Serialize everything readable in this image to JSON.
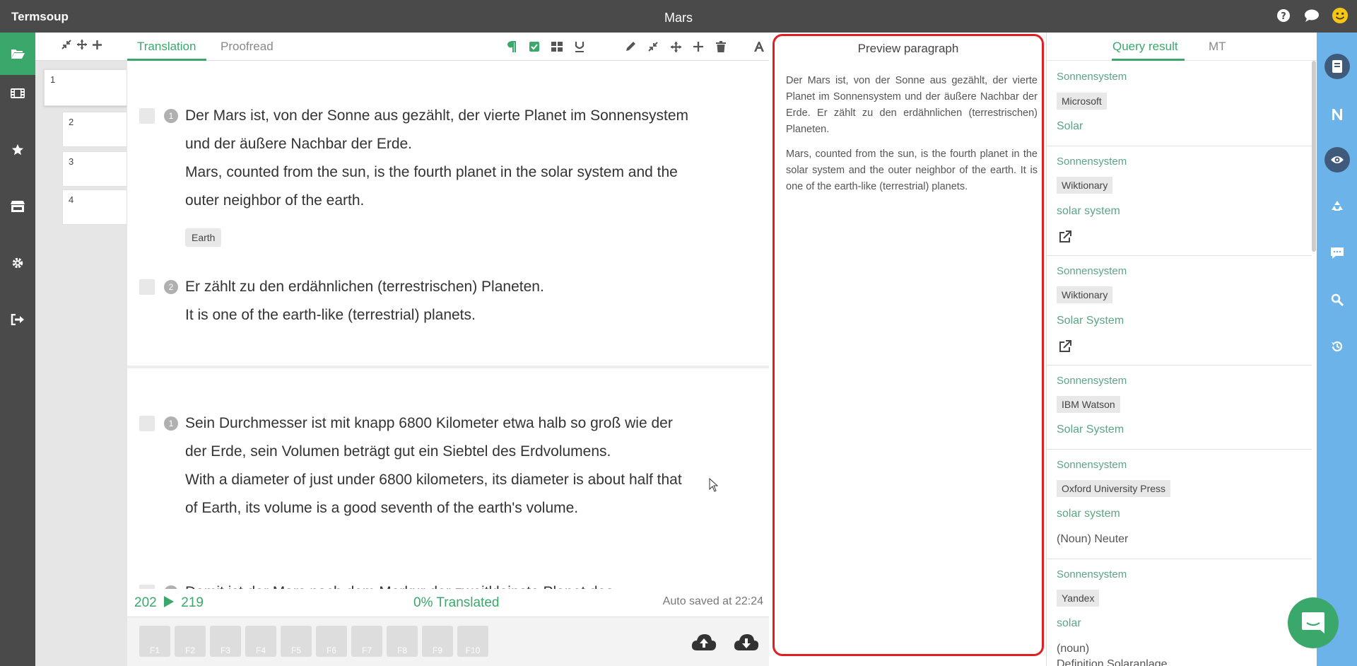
{
  "app": {
    "name": "Termsoup",
    "document_title": "Mars"
  },
  "colors": {
    "accent": "#3aa86b",
    "dark": "#4a4a4a",
    "preview_border": "#e02020",
    "right_nav": "#6cb3ea"
  },
  "topbar_icons": [
    "help-icon",
    "chat-icon",
    "smiley-icon"
  ],
  "left_nav": [
    "folder-open-icon",
    "film-icon",
    "star-icon",
    "store-icon",
    "gear-icon",
    "sign-out-icon"
  ],
  "page_strip": {
    "tools": [
      "compress-icon",
      "move-icon",
      "plus-icon"
    ],
    "pages": [
      "1",
      "2",
      "3",
      "4"
    ]
  },
  "editor": {
    "tabs": [
      {
        "label": "Translation"
      },
      {
        "label": "Proofread"
      }
    ],
    "toolbar": [
      "paragraph-icon",
      "check-square-icon",
      "grid-icon",
      "underline-icon",
      "pencil-icon",
      "compress-icon",
      "move-icon",
      "plus-icon",
      "trash-icon",
      "font-icon"
    ],
    "paragraphs": [
      {
        "segments": [
          {
            "number": "1",
            "source": "Der Mars ist, von der Sonne aus gezählt, der vierte Planet im Sonnensystem und der äußere Nachbar der Erde.",
            "target": "Mars, counted from the sun, is the fourth planet in the solar system and the outer neighbor of the earth.",
            "chip": "Earth"
          },
          {
            "number": "2",
            "source": "Er zählt zu den erdähnlichen (terrestrischen) Planeten.",
            "target": "It is one of the earth-like (terrestrial) planets."
          }
        ]
      },
      {
        "segments": [
          {
            "number": "1",
            "source": "Sein Durchmesser ist mit knapp 6800 Kilometer etwa halb so groß wie der der Erde, sein Volumen beträgt gut ein Siebtel des Erdvolumens.",
            "target": "With a diameter of just under 6800 kilometers, its diameter is about half that of Earth, its volume is a good seventh of the earth's volume."
          },
          {
            "number": "2",
            "source": "Damit ist der Mars nach dem Merkur der zweitkleinste Planet des"
          }
        ]
      }
    ],
    "status": {
      "from": "202",
      "to": "219",
      "progress": "0% Translated",
      "saved": "Auto saved at 22:24"
    },
    "function_keys": [
      "F1",
      "F2",
      "F3",
      "F4",
      "F5",
      "F6",
      "F7",
      "F8",
      "F9",
      "F10"
    ],
    "cloud_icons": [
      "cloud-upload-icon",
      "cloud-download-icon"
    ]
  },
  "preview": {
    "title": "Preview paragraph",
    "paragraphs": [
      "Der Mars ist, von der Sonne aus gezählt, der vierte Planet im Sonnensystem und der äußere Nachbar der Erde. Er zählt zu den erdähnlichen (terrestrischen) Planeten.",
      "Mars, counted from the sun, is the fourth planet in the solar system and the outer neighbor of the earth.  It is one of the earth-like (terrestrial) planets."
    ]
  },
  "query": {
    "tabs": [
      {
        "label": "Query result"
      },
      {
        "label": "MT"
      }
    ],
    "results": [
      {
        "term": "Sonnensystem",
        "source": "Microsoft",
        "target": "Solar"
      },
      {
        "term": "Sonnensystem",
        "source": "Wiktionary",
        "target": "solar system",
        "link": true
      },
      {
        "term": "Sonnensystem",
        "source": "Wiktionary",
        "target": "Solar System",
        "link": true
      },
      {
        "term": "Sonnensystem",
        "source": "IBM Watson",
        "target": "Solar System"
      },
      {
        "term": "Sonnensystem",
        "source": "Oxford University Press",
        "target": "solar system",
        "note": "(Noun) Neuter"
      },
      {
        "term": "Sonnensystem",
        "source": "Yandex",
        "target": "solar",
        "note": "(noun)",
        "note2": "Definition Solaranlage"
      }
    ]
  },
  "right_nav": [
    "notebook-icon",
    "n-icon",
    "eye-icon",
    "recycle-icon",
    "comment-icon",
    "search-icon",
    "history-icon"
  ]
}
